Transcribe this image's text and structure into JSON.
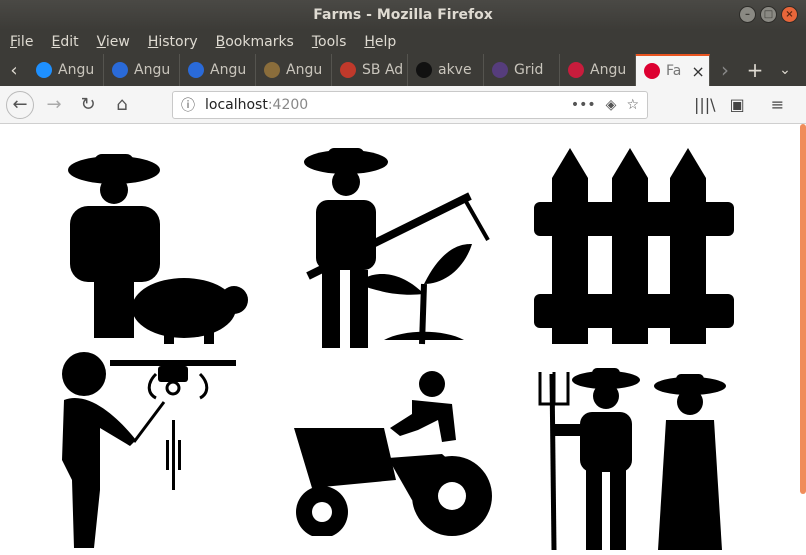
{
  "window": {
    "title": "Farms - Mozilla Firefox"
  },
  "menu": [
    {
      "label": "File",
      "u": "F",
      "rest": "ile"
    },
    {
      "label": "Edit",
      "u": "E",
      "rest": "dit"
    },
    {
      "label": "View",
      "u": "V",
      "rest": "iew"
    },
    {
      "label": "History",
      "u": "H",
      "rest": "istory"
    },
    {
      "label": "Bookmarks",
      "u": "B",
      "rest": "ookmarks"
    },
    {
      "label": "Tools",
      "u": "T",
      "rest": "ools"
    },
    {
      "label": "Help",
      "u": "H",
      "rest": "elp"
    }
  ],
  "tabs": [
    {
      "label": "Angu",
      "icon": "lightning-icon",
      "color": "#1e90ff"
    },
    {
      "label": "Angu",
      "icon": "bootstrap-icon",
      "color": "#2a6ad8"
    },
    {
      "label": "Angu",
      "icon": "bootstrap-icon",
      "color": "#2a6ad8"
    },
    {
      "label": "Angu",
      "icon": "google-icon",
      "color": "#8a6d3b"
    },
    {
      "label": "SB Ad",
      "icon": "sb-admin-icon",
      "color": "#c0392b"
    },
    {
      "label": "akve",
      "icon": "github-icon",
      "color": "#111111"
    },
    {
      "label": "Grid",
      "icon": "bootstrap-icon",
      "color": "#563d7c"
    },
    {
      "label": "Angu",
      "icon": "bootstrap-icon",
      "color": "#c81c3c"
    },
    {
      "label": "Fa",
      "icon": "angular-icon",
      "color": "#dd0031",
      "active": true
    }
  ],
  "url": {
    "host": "localhost",
    "port": ":4200"
  },
  "images": [
    "farmer-with-pig-icon",
    "farmer-with-hoe-icon",
    "fence-icon",
    "drone-operator-icon",
    "tractor-driver-icon",
    "farmer-couple-icon"
  ]
}
